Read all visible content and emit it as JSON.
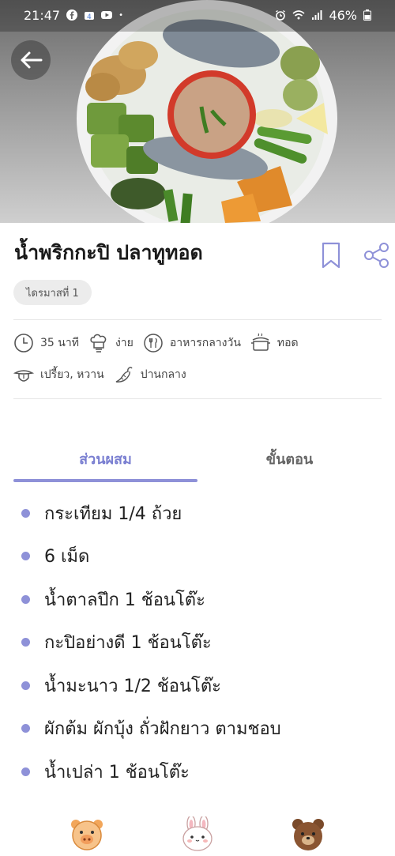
{
  "status_bar": {
    "time": "21:47",
    "battery": "46%",
    "icons": [
      "facebook-icon",
      "store-icon",
      "youtube-icon",
      "alarm-icon",
      "wifi-icon",
      "signal-icon",
      "battery-icon"
    ]
  },
  "recipe": {
    "title": "น้ำพริกกะปิ ปลาทูทอด",
    "tag": "ไดรมาสที่ 1",
    "meta": {
      "time": "35 นาที",
      "difficulty": "ง่าย",
      "meal": "อาหารกลางวัน",
      "method": "ทอด",
      "taste": "เปรี้ยว, หวาน",
      "spice": "ปานกลาง"
    }
  },
  "tabs": {
    "ingredients_label": "ส่วนผสม",
    "steps_label": "ขั้นตอน",
    "active": "ingredients"
  },
  "ingredients": [
    "กระเทียม 1/4 ถ้วย",
    "6 เม็ด",
    "น้ำตาลปึก 1 ช้อนโต๊ะ",
    "กะปิอย่างดี 1 ช้อนโต๊ะ",
    "น้ำมะนาว 1/2 ช้อนโต๊ะ",
    "ผักต้ม ผักบุ้ง ถั่วฝักยาว ตามชอบ",
    "น้ำเปล่า 1 ช้อนโต๊ะ"
  ],
  "colors": {
    "accent": "#8e91d8",
    "accent_text": "#7a7fd1"
  },
  "bottom_bar": {
    "stickers": [
      "pig-face-icon",
      "bunny-face-icon",
      "bear-face-icon"
    ]
  }
}
